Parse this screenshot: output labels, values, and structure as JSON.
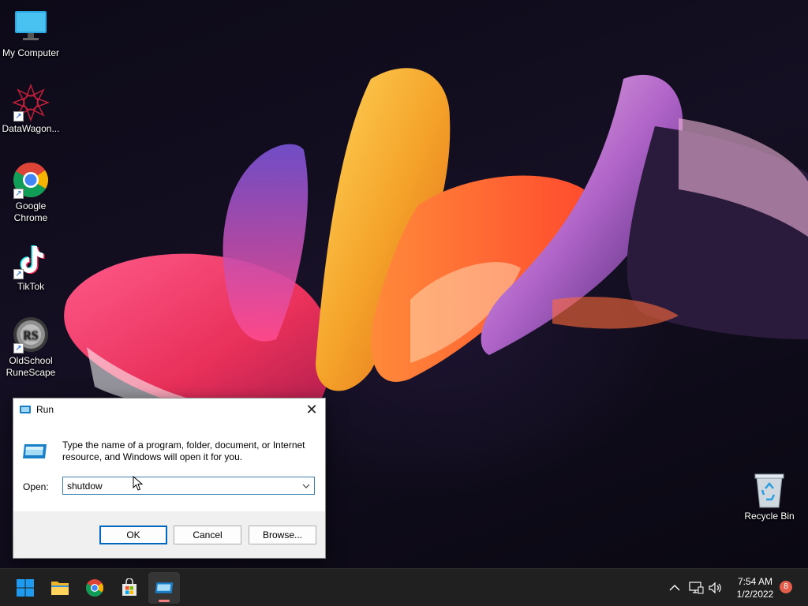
{
  "desktop": {
    "icons": [
      {
        "label": "My Computer",
        "icon": "monitor-icon"
      },
      {
        "label": "DataWagon...",
        "icon": "datawagon-icon"
      },
      {
        "label": "Google Chrome",
        "icon": "chrome-icon"
      },
      {
        "label": "TikTok",
        "icon": "tiktok-icon"
      },
      {
        "label": "OldSchool RuneScape",
        "icon": "runescape-icon"
      },
      {
        "label": "Recycle Bin",
        "icon": "recycle-bin-icon"
      }
    ]
  },
  "run_dialog": {
    "title": "Run",
    "close_glyph": "✕",
    "description": "Type the name of a program, folder, document, or Internet resource, and Windows will open it for you.",
    "open_label": "Open:",
    "open_value": "shutdow",
    "buttons": {
      "ok": "OK",
      "cancel": "Cancel",
      "browse": "Browse..."
    }
  },
  "taskbar": {
    "apps": [
      "start-icon",
      "file-explorer-icon",
      "chrome-icon",
      "store-icon",
      "run-icon"
    ],
    "active_app": "run-icon",
    "tray": [
      "chevron-up-icon",
      "network-icon",
      "volume-icon"
    ],
    "time": "7:54 AM",
    "date": "1/2/2022",
    "notification_count": "8"
  },
  "colors": {
    "accent": "#0067c0",
    "taskbar": "#202020",
    "badge": "#e35e4b"
  }
}
